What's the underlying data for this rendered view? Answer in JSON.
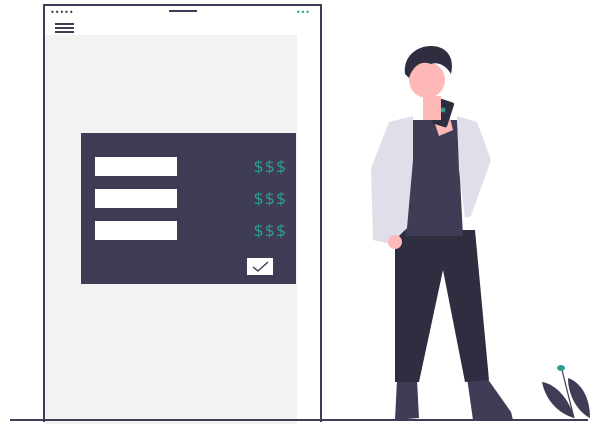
{
  "status_bar": {
    "signal_dots": "•••••",
    "battery_dots": "•••"
  },
  "payments": {
    "rows": [
      {
        "amount": "$$$"
      },
      {
        "amount": "$$$"
      },
      {
        "amount": "$$$"
      }
    ]
  },
  "icons": {
    "menu": "menu-icon",
    "check": "check-icon",
    "phone": "phone-icon"
  },
  "colors": {
    "dark": "#3f3d56",
    "accent": "#2f9e8f",
    "panel": "#f2f2f2",
    "jacket": "#e0dfe9",
    "skin": "#ffb8b8"
  }
}
